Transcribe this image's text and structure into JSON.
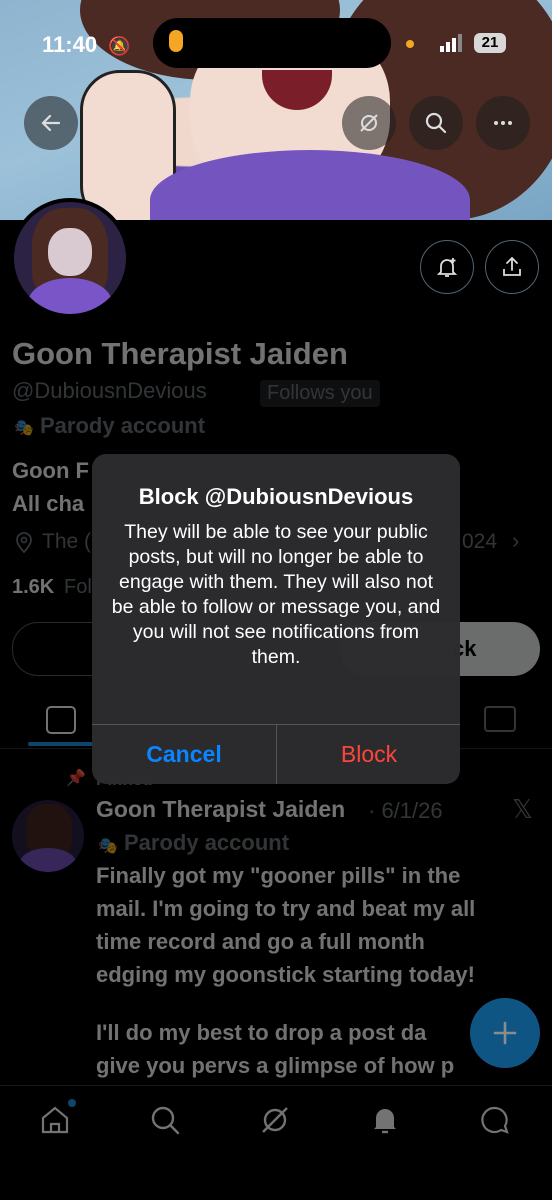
{
  "status_bar": {
    "time": "11:40",
    "battery": "21"
  },
  "profile": {
    "name": "Goon Therapist Jaiden",
    "handle": "@DubiousnDevious",
    "follows_you": "Follows you",
    "parody_label": "Parody account",
    "bio_line1": "Goon F",
    "bio_line2": "All cha",
    "location_prefix": "The (",
    "date_suffix": "024",
    "followers_prefix": "1.6K",
    "followers_word": "Fol",
    "button_suffix": "ck"
  },
  "dialog": {
    "title": "Block @DubiousnDevious",
    "message": "They will be able to see your public posts, but will no longer be able to engage with them. They will also not be able to follow or message you, and you will not see notifications from them.",
    "cancel": "Cancel",
    "block": "Block"
  },
  "post": {
    "pinned_label": "Pinned",
    "author": "Goon Therapist Jaiden",
    "date": "· 6/1/26",
    "parody_label": "Parody account",
    "text_line1": "Finally got my \"gooner pills\" in the",
    "text_line2": "mail. I'm going to try and beat my all",
    "text_line3": "time record and go a full month",
    "text_line4": "edging my goonstick starting today!",
    "text_line5": "I'll do my best to drop a post da",
    "text_line6": "give you pervs a glimpse of how p"
  },
  "colors": {
    "accent": "#1d9bf0",
    "destructive": "#ff453a",
    "cancel": "#0a84ff"
  },
  "icons": [
    "back-arrow-icon",
    "grok-icon",
    "search-icon",
    "more-icon",
    "notification-bell-plus-icon",
    "share-icon",
    "location-icon",
    "home-icon",
    "search-icon",
    "grok-icon",
    "bell-icon",
    "messages-icon",
    "compose-plus-icon"
  ]
}
